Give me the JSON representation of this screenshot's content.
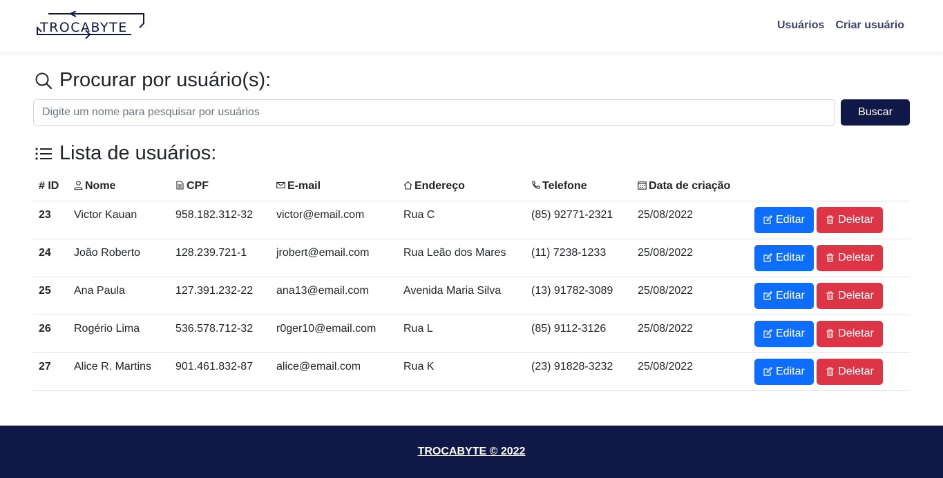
{
  "brand": {
    "logo_text": "TROCABYTE"
  },
  "nav": {
    "items": [
      {
        "label": "Usuários"
      },
      {
        "label": "Criar usuário"
      }
    ]
  },
  "search": {
    "title": "Procurar por usuário(s):",
    "placeholder": "Digite um nome para pesquisar por usuários",
    "value": "",
    "button_label": "Buscar"
  },
  "list": {
    "title": "Lista de usuários:",
    "columns": {
      "id": "# ID",
      "name": "Nome",
      "cpf": "CPF",
      "email": "E-mail",
      "address": "Endereço",
      "phone": "Telefone",
      "created": "Data de criação"
    },
    "rows": [
      {
        "id": "23",
        "name": "Victor Kauan",
        "cpf": "958.182.312-32",
        "email": "victor@email.com",
        "address": "Rua C",
        "phone": "(85) 92771-2321",
        "created": "25/08/2022"
      },
      {
        "id": "24",
        "name": "João Roberto",
        "cpf": "128.239.721-1",
        "email": "jrobert@email.com",
        "address": "Rua Leão dos Mares",
        "phone": "(11) 7238-1233",
        "created": "25/08/2022"
      },
      {
        "id": "25",
        "name": "Ana Paula",
        "cpf": "127.391.232-22",
        "email": "ana13@email.com",
        "address": "Avenida Maria Silva",
        "phone": "(13) 91782-3089",
        "created": "25/08/2022"
      },
      {
        "id": "26",
        "name": "Rogério Lima",
        "cpf": "536.578.712-32",
        "email": "r0ger10@email.com",
        "address": "Rua L",
        "phone": "(85) 9112-3126",
        "created": "25/08/2022"
      },
      {
        "id": "27",
        "name": "Alice R. Martins",
        "cpf": "901.461.832-87",
        "email": "alice@email.com",
        "address": "Rua K",
        "phone": "(23) 91828-3232",
        "created": "25/08/2022"
      }
    ],
    "edit_label": "Editar",
    "delete_label": "Deletar"
  },
  "footer": {
    "text": "TROCABYTE © 2022"
  },
  "colors": {
    "primary_dark": "#101848",
    "edit": "#0d6efd",
    "delete": "#dc3545"
  }
}
